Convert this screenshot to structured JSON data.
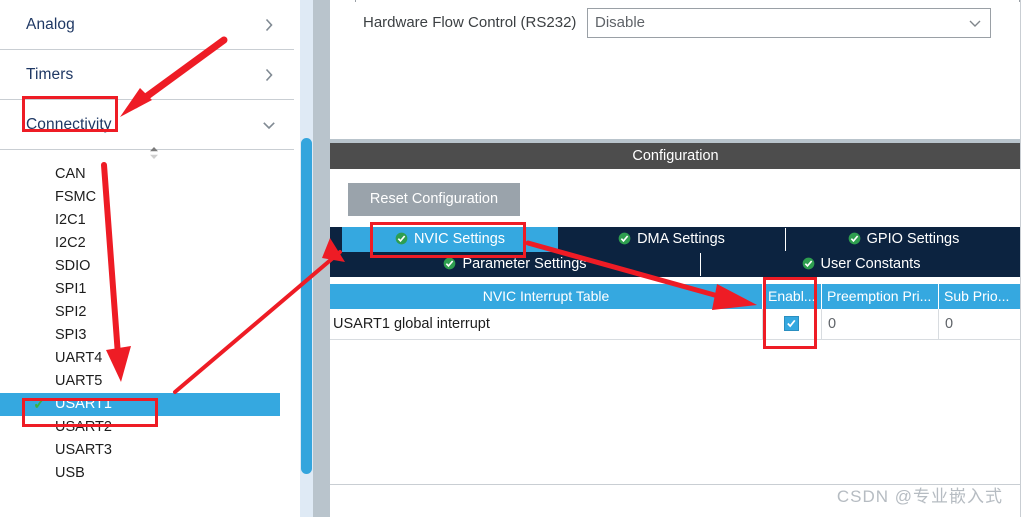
{
  "sidebar": {
    "categories": [
      {
        "label": "Analog",
        "chevron": "chevron-right-icon"
      },
      {
        "label": "Timers",
        "chevron": "chevron-right-icon"
      },
      {
        "label": "Connectivity",
        "chevron": "chevron-down-icon"
      }
    ],
    "spinner_icon": "up-down-spinner-icon",
    "peripherals": [
      {
        "label": "CAN",
        "selected": false,
        "checked": false
      },
      {
        "label": "FSMC",
        "selected": false,
        "checked": false
      },
      {
        "label": "I2C1",
        "selected": false,
        "checked": false
      },
      {
        "label": "I2C2",
        "selected": false,
        "checked": false
      },
      {
        "label": "SDIO",
        "selected": false,
        "checked": false
      },
      {
        "label": "SPI1",
        "selected": false,
        "checked": false
      },
      {
        "label": "SPI2",
        "selected": false,
        "checked": false
      },
      {
        "label": "SPI3",
        "selected": false,
        "checked": false
      },
      {
        "label": "UART4",
        "selected": false,
        "checked": false
      },
      {
        "label": "UART5",
        "selected": false,
        "checked": false
      },
      {
        "label": "USART1",
        "selected": true,
        "checked": true
      },
      {
        "label": "USART2",
        "selected": false,
        "checked": false
      },
      {
        "label": "USART3",
        "selected": false,
        "checked": false
      },
      {
        "label": "USB",
        "selected": false,
        "checked": false
      }
    ]
  },
  "form": {
    "hardware_flow_control_label": "Hardware Flow Control (RS232)",
    "hardware_flow_control_value": "Disable",
    "dropdown_caret_icon": "chevron-down-icon"
  },
  "configuration": {
    "header_title": "Configuration",
    "reset_button": "Reset Configuration",
    "tabs_row1": [
      {
        "label": "NVIC Settings",
        "active": true,
        "icon": "green-check-circle-icon"
      },
      {
        "label": "DMA Settings",
        "active": false,
        "icon": "green-check-circle-icon"
      },
      {
        "label": "GPIO Settings",
        "active": false,
        "icon": "green-check-circle-icon"
      }
    ],
    "tabs_row2": [
      {
        "label": "Parameter Settings",
        "active": false,
        "icon": "green-check-circle-icon"
      },
      {
        "label": "User Constants",
        "active": false,
        "icon": "green-check-circle-icon"
      }
    ]
  },
  "nvic_table": {
    "columns": [
      "NVIC Interrupt Table",
      "Enabl...",
      "Preemption Pri...",
      "Sub Prio..."
    ],
    "rows": [
      {
        "name": "USART1 global interrupt",
        "enabled": true,
        "preemption_priority": "0",
        "sub_priority": "0"
      }
    ]
  },
  "watermark": "CSDN @专业嵌入式",
  "colors": {
    "accent_blue": "#35a8e0",
    "tab_navy": "#0c2340",
    "header_gray": "#4d4d4d",
    "annotation_red": "#ee1c25",
    "check_green": "#3cb043"
  }
}
